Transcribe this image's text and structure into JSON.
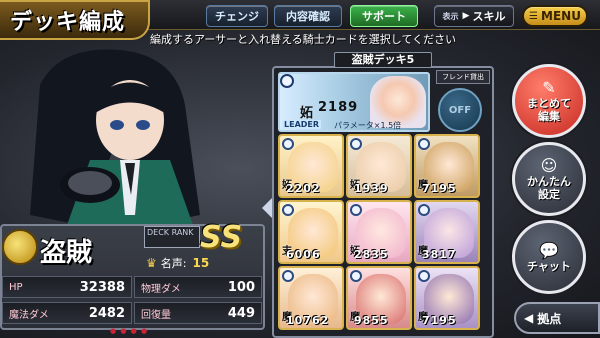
{
  "header": {
    "title": "デッキ編成",
    "buttons": {
      "change": "チェンジ",
      "content_check": "内容確認",
      "support": "サポート",
      "display_prefix": "表示",
      "skill": "スキル",
      "menu": "MENU"
    },
    "instruction": "編成するアーサーと入れ替える騎士カードを選択してください"
  },
  "deck": {
    "name": "盗賊デッキ5",
    "friend_label": "フレンド貸出",
    "friend_toggle": "OFF",
    "leader": {
      "class": "妬",
      "value": "2189",
      "badge": "LEADER",
      "bonus": "パラメータ×1.5倍"
    },
    "cards": [
      {
        "class": "妬",
        "value": "2202"
      },
      {
        "class": "妬",
        "value": "1939"
      },
      {
        "class": "魔",
        "value": "7195"
      },
      {
        "class": "支",
        "value": "6006"
      },
      {
        "class": "妬",
        "value": "2835"
      },
      {
        "class": "魔",
        "value": "3817"
      },
      {
        "class": "魔",
        "value": "10762"
      },
      {
        "class": "魔",
        "value": "9855"
      },
      {
        "class": "魔",
        "value": "7195"
      }
    ]
  },
  "info": {
    "deck_type": "盗賊",
    "rank_label": "DECK RANK",
    "rank": "SS",
    "fame_label": "名声:",
    "fame_value": "15",
    "stats": {
      "hp_label": "HP",
      "hp": "32388",
      "patk_label": "物理ダメ",
      "patk": "100",
      "matk_label": "魔法ダメ",
      "matk": "2482",
      "heal_label": "回復量",
      "heal": "449"
    }
  },
  "side_buttons": {
    "auto": "まとめて編集",
    "easy": "かんたん設定",
    "chat": "チャット",
    "home": "拠点"
  },
  "colors": {
    "gold": "#d8b24c",
    "support_green": "#3bb34b",
    "auto_red": "#c72a22",
    "menu_yellow": "#f7d04a"
  }
}
